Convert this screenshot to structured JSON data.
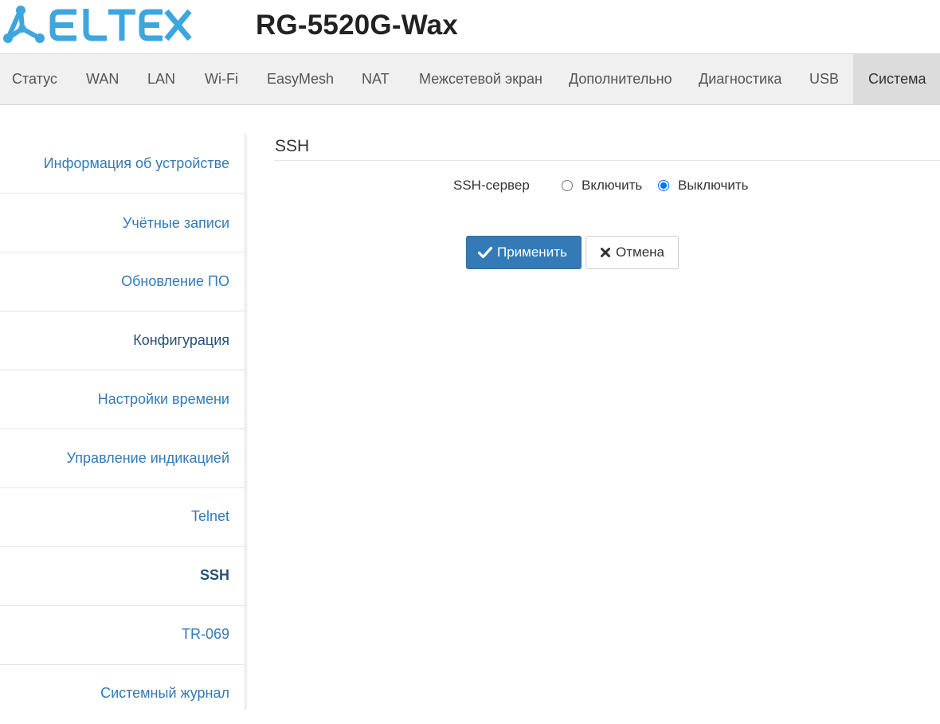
{
  "header": {
    "brand": "ELTEX",
    "model": "RG-5520G-Wax",
    "brand_color": "#3ea6de"
  },
  "topnav": {
    "items": [
      {
        "label": "Статус"
      },
      {
        "label": "WAN"
      },
      {
        "label": "LAN"
      },
      {
        "label": "Wi-Fi"
      },
      {
        "label": "EasyMesh"
      },
      {
        "label": "NAT"
      },
      {
        "label": "Межсетевой экран"
      },
      {
        "label": "Дополнительно"
      },
      {
        "label": "Диагностика"
      },
      {
        "label": "USB"
      },
      {
        "label": "Система",
        "active": true
      }
    ]
  },
  "sidebar": {
    "items": [
      {
        "label": "Информация об устройстве"
      },
      {
        "label": "Учётные записи"
      },
      {
        "label": "Обновление ПО"
      },
      {
        "label": "Конфигурация"
      },
      {
        "label": "Настройки времени"
      },
      {
        "label": "Управление индикацией"
      },
      {
        "label": "Telnet"
      },
      {
        "label": "SSH",
        "active": true
      },
      {
        "label": "TR-069"
      },
      {
        "label": "Системный журнал"
      }
    ]
  },
  "main": {
    "section_title": "SSH",
    "ssh_server": {
      "label": "SSH-сервер",
      "options": [
        {
          "label": "Включить",
          "checked": false
        },
        {
          "label": "Выключить",
          "checked": true
        }
      ]
    },
    "buttons": {
      "apply_label": "Применить",
      "cancel_label": "Отмена"
    }
  },
  "icons": {
    "apply": "check-icon",
    "cancel": "close-icon"
  },
  "colors": {
    "primary": "#337ab7",
    "link": "#337ab7",
    "radio_checked": "#0075ff",
    "nav_bg": "#f0f0f0",
    "nav_active_bg": "#dcdcdc"
  }
}
